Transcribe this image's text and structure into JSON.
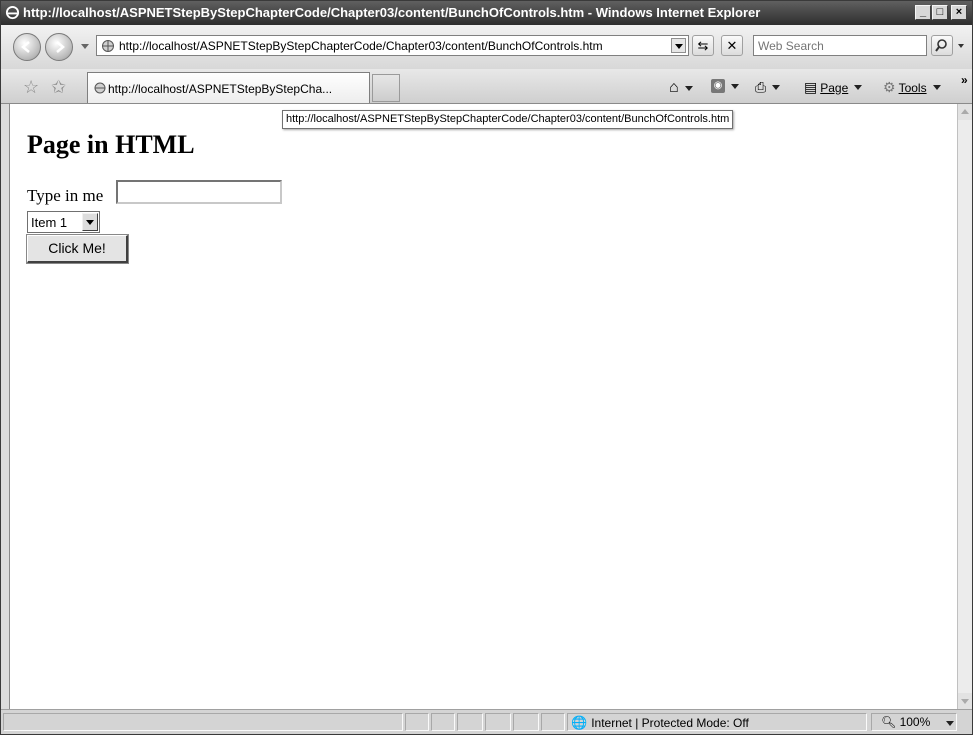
{
  "window": {
    "title": "http://localhost/ASPNETStepByStepChapterCode/Chapter03/content/BunchOfControls.htm - Windows Internet Explorer",
    "minimize": "_",
    "maximize": "□",
    "close": "×"
  },
  "address_bar": {
    "url": "http://localhost/ASPNETStepByStepChapterCode/Chapter03/content/BunchOfControls.htm"
  },
  "search": {
    "placeholder": "Web Search"
  },
  "tab": {
    "label": "http://localhost/ASPNETStepByStepCha..."
  },
  "commands": {
    "page": "Page",
    "tools": "Tools",
    "overflow": "»"
  },
  "tooltip": {
    "text": "http://localhost/ASPNETStepByStepChapterCode/Chapter03/content/BunchOfControls.htm"
  },
  "content": {
    "heading": "Page in HTML",
    "textbox_label": "Type in me",
    "textbox_value": "",
    "select_value": "Item 1",
    "button_label": "Click Me!"
  },
  "status": {
    "zone": "Internet | Protected Mode: Off",
    "zoom": "100%"
  }
}
